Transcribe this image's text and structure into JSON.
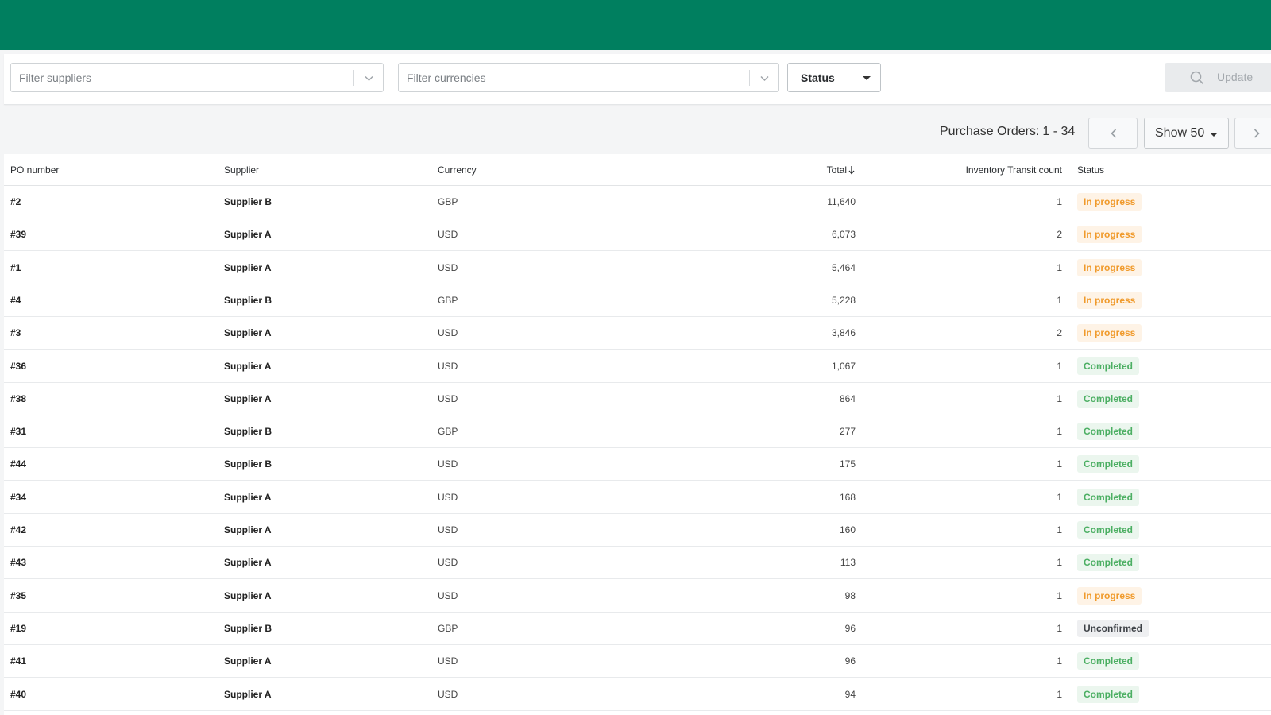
{
  "colors": {
    "brand": "#007f5f",
    "in_progress": "#f09a2b",
    "completed": "#4caf63",
    "unconfirmed": "#3d4146"
  },
  "filters": {
    "suppliers_placeholder": "Filter suppliers",
    "currencies_placeholder": "Filter currencies",
    "status_label": "Status",
    "update_label": "Update",
    "update_icon": "search-icon"
  },
  "pager": {
    "label": "Purchase Orders:",
    "range": "1 - 34",
    "show_label": "Show 50",
    "prev_icon": "chevron-left-icon",
    "next_icon": "chevron-right-icon"
  },
  "table": {
    "columns": {
      "po_number": "PO number",
      "supplier": "Supplier",
      "currency": "Currency",
      "total": "Total",
      "inventory_transit_count": "Inventory Transit count",
      "status": "Status"
    },
    "sort": {
      "column": "total",
      "direction": "desc",
      "icon": "arrow-down-icon"
    },
    "rows": [
      {
        "po": "#2",
        "supplier": "Supplier B",
        "currency": "GBP",
        "total": "11,640",
        "inv": "1",
        "status": "In progress",
        "kind": "progress"
      },
      {
        "po": "#39",
        "supplier": "Supplier A",
        "currency": "USD",
        "total": "6,073",
        "inv": "2",
        "status": "In progress",
        "kind": "progress"
      },
      {
        "po": "#1",
        "supplier": "Supplier A",
        "currency": "USD",
        "total": "5,464",
        "inv": "1",
        "status": "In progress",
        "kind": "progress"
      },
      {
        "po": "#4",
        "supplier": "Supplier B",
        "currency": "GBP",
        "total": "5,228",
        "inv": "1",
        "status": "In progress",
        "kind": "progress"
      },
      {
        "po": "#3",
        "supplier": "Supplier A",
        "currency": "USD",
        "total": "3,846",
        "inv": "2",
        "status": "In progress",
        "kind": "progress"
      },
      {
        "po": "#36",
        "supplier": "Supplier A",
        "currency": "USD",
        "total": "1,067",
        "inv": "1",
        "status": "Completed",
        "kind": "completed"
      },
      {
        "po": "#38",
        "supplier": "Supplier A",
        "currency": "USD",
        "total": "864",
        "inv": "1",
        "status": "Completed",
        "kind": "completed"
      },
      {
        "po": "#31",
        "supplier": "Supplier B",
        "currency": "GBP",
        "total": "277",
        "inv": "1",
        "status": "Completed",
        "kind": "completed"
      },
      {
        "po": "#44",
        "supplier": "Supplier B",
        "currency": "USD",
        "total": "175",
        "inv": "1",
        "status": "Completed",
        "kind": "completed"
      },
      {
        "po": "#34",
        "supplier": "Supplier A",
        "currency": "USD",
        "total": "168",
        "inv": "1",
        "status": "Completed",
        "kind": "completed"
      },
      {
        "po": "#42",
        "supplier": "Supplier A",
        "currency": "USD",
        "total": "160",
        "inv": "1",
        "status": "Completed",
        "kind": "completed"
      },
      {
        "po": "#43",
        "supplier": "Supplier A",
        "currency": "USD",
        "total": "113",
        "inv": "1",
        "status": "Completed",
        "kind": "completed"
      },
      {
        "po": "#35",
        "supplier": "Supplier A",
        "currency": "USD",
        "total": "98",
        "inv": "1",
        "status": "In progress",
        "kind": "progress"
      },
      {
        "po": "#19",
        "supplier": "Supplier B",
        "currency": "GBP",
        "total": "96",
        "inv": "1",
        "status": "Unconfirmed",
        "kind": "unconfirmed"
      },
      {
        "po": "#41",
        "supplier": "Supplier A",
        "currency": "USD",
        "total": "96",
        "inv": "1",
        "status": "Completed",
        "kind": "completed"
      },
      {
        "po": "#40",
        "supplier": "Supplier A",
        "currency": "USD",
        "total": "94",
        "inv": "1",
        "status": "Completed",
        "kind": "completed"
      }
    ]
  }
}
